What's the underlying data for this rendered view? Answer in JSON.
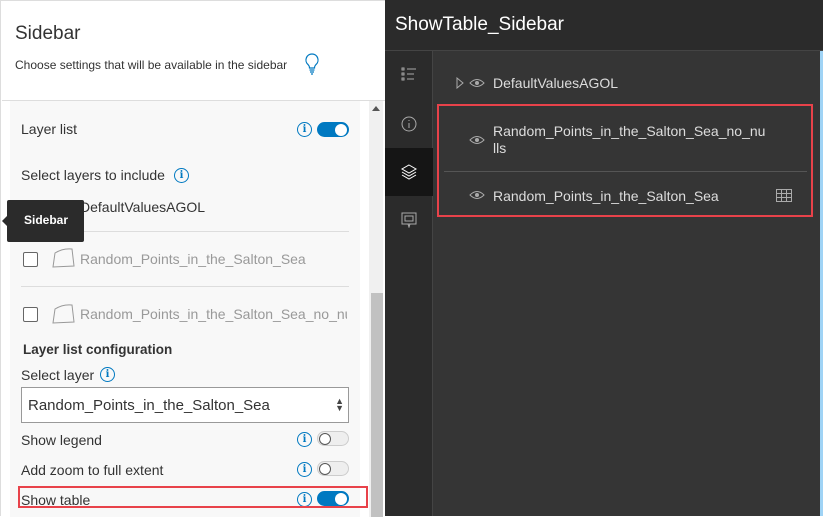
{
  "settings": {
    "title": "Sidebar",
    "subtitle": "Choose settings that will be available in the sidebar",
    "layer_list_label": "Layer list",
    "layer_list_enabled": true,
    "select_layers_label": "Select layers to include",
    "layers": [
      {
        "name": "DefaultValuesAGOL",
        "checked": null
      },
      {
        "name": "Random_Points_in_the_Salton_Sea",
        "checked": false
      },
      {
        "name": "Random_Points_in_the_Salton_Sea_no_nulls",
        "checked": false
      }
    ],
    "config_heading": "Layer list configuration",
    "select_layer_label": "Select layer",
    "selected_layer": "Random_Points_in_the_Salton_Sea",
    "options": [
      {
        "label": "Show legend",
        "on": false
      },
      {
        "label": "Add zoom to full extent",
        "on": false
      },
      {
        "label": "Show table",
        "on": true
      }
    ],
    "tooltip": "Sidebar"
  },
  "preview": {
    "title": "ShowTable_Sidebar",
    "rail_icons": [
      "legend-icon",
      "info-icon",
      "layers-icon",
      "bookmark-icon"
    ],
    "layers": [
      {
        "name": "DefaultValuesAGOL"
      },
      {
        "name_line1": "Random_Points_in_the_Salton_Sea_no_nu",
        "name_line2": "lls"
      },
      {
        "name": "Random_Points_in_the_Salton_Sea"
      }
    ]
  },
  "colors": {
    "accent": "#0079c1",
    "highlight": "#e8424a"
  }
}
